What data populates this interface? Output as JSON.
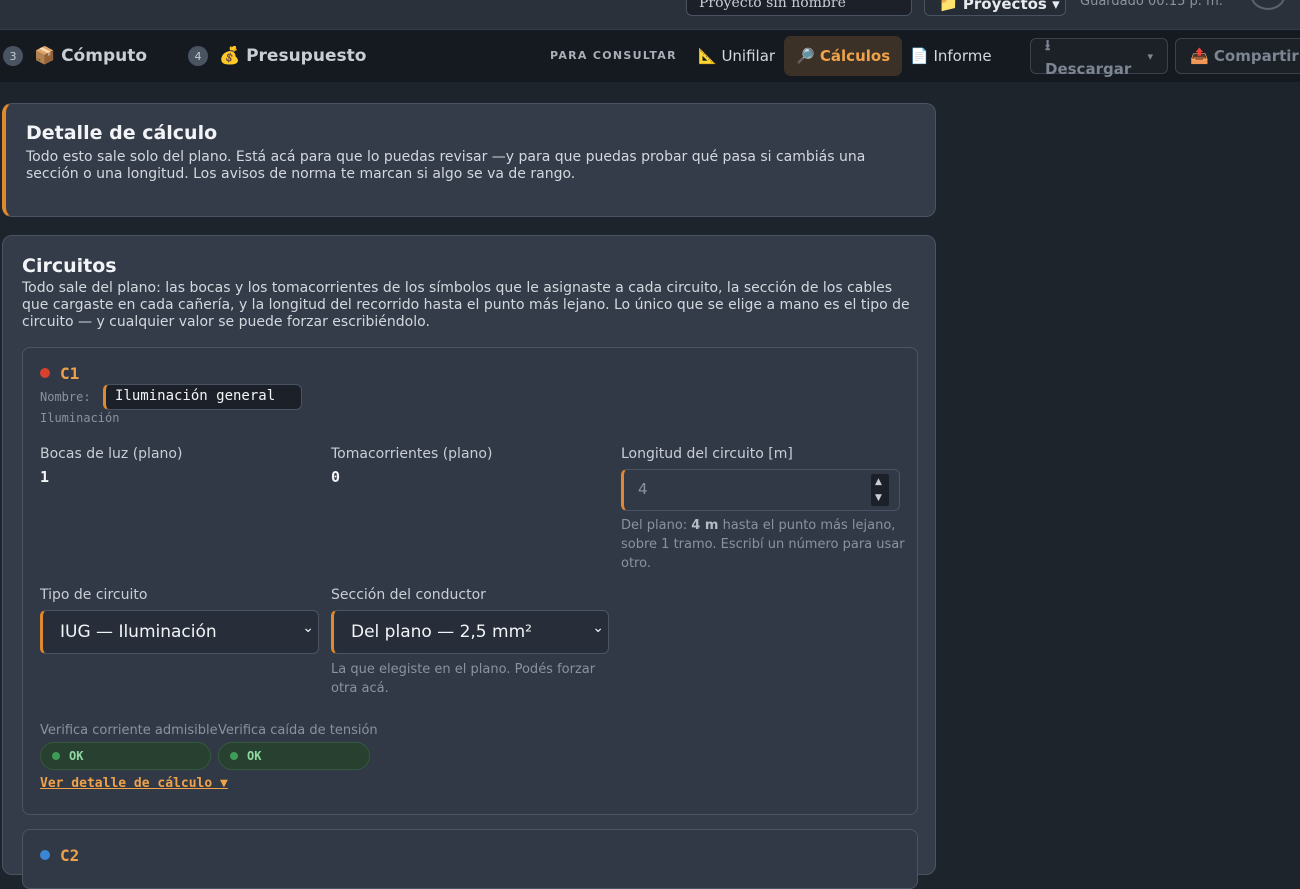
{
  "topbar": {
    "project_input_value": "Proyecto sin nombre",
    "projects_button": "📁 Proyectos ▾",
    "saved_status": "Guardado 00:15 p. m."
  },
  "steps": [
    {
      "number": "3",
      "label": "📦 Cómputo"
    },
    {
      "number": "4",
      "label": "💰 Presupuesto"
    }
  ],
  "consult": {
    "heading": "PARA CONSULTAR",
    "tabs": [
      {
        "label": "📐 Unifilar",
        "active": false
      },
      {
        "label": "🔎 Cálculos",
        "active": true
      },
      {
        "label": "📄 Informe",
        "active": false
      }
    ]
  },
  "actions": {
    "download": "⭳ Descargar",
    "download_caret": "▾",
    "share": "📤 Compartir"
  },
  "intro": {
    "title": "Detalle de cálculo",
    "text": "Todo esto sale solo del plano. Está acá para que lo puedas revisar —y para que puedas probar qué pasa si cambiás una sección o una longitud. Los avisos de norma te marcan si algo se va de rango."
  },
  "circuits": {
    "title": "Circuitos",
    "description": "Todo sale del plano: las bocas y los tomacorrientes de los símbolos que le asignaste a cada circuito, la sección de los cables que cargaste en cada cañería, y la longitud del recorrido hasta el punto más lejano. Lo único que se elige a mano es el tipo de circuito — y cualquier valor se puede forzar escribiéndolo.",
    "items": [
      {
        "id": "C1",
        "color": "#d9412e",
        "name_label": "Nombre:",
        "name_value": "Iluminación general",
        "category": "Iluminación",
        "lights_label": "Bocas de luz (plano)",
        "lights_value": "1",
        "outlets_label": "Tomacorrientes (plano)",
        "outlets_value": "0",
        "length_label": "Longitud del circuito [m]",
        "length_placeholder": "4",
        "length_hint_prefix": "Del plano:",
        "length_hint_value": "4 m",
        "length_hint_suffix": "hasta el punto más lejano, sobre 1 tramo. Escribí un número para usar otro.",
        "type_label": "Tipo de circuito",
        "type_value": "IUG — Iluminación",
        "section_label": "Sección del conductor",
        "section_value": "Del plano — 2,5 mm²",
        "section_hint": "La que elegiste en el plano. Podés forzar otra acá.",
        "check_current_label": "Verifica corriente admisible",
        "check_current_value": "OK",
        "check_voltage_label": "Verifica caída de tensión",
        "check_voltage_value": "OK",
        "detail_link": "Ver detalle de cálculo ▼"
      },
      {
        "id": "C2",
        "color": "#3a86d4"
      }
    ]
  }
}
